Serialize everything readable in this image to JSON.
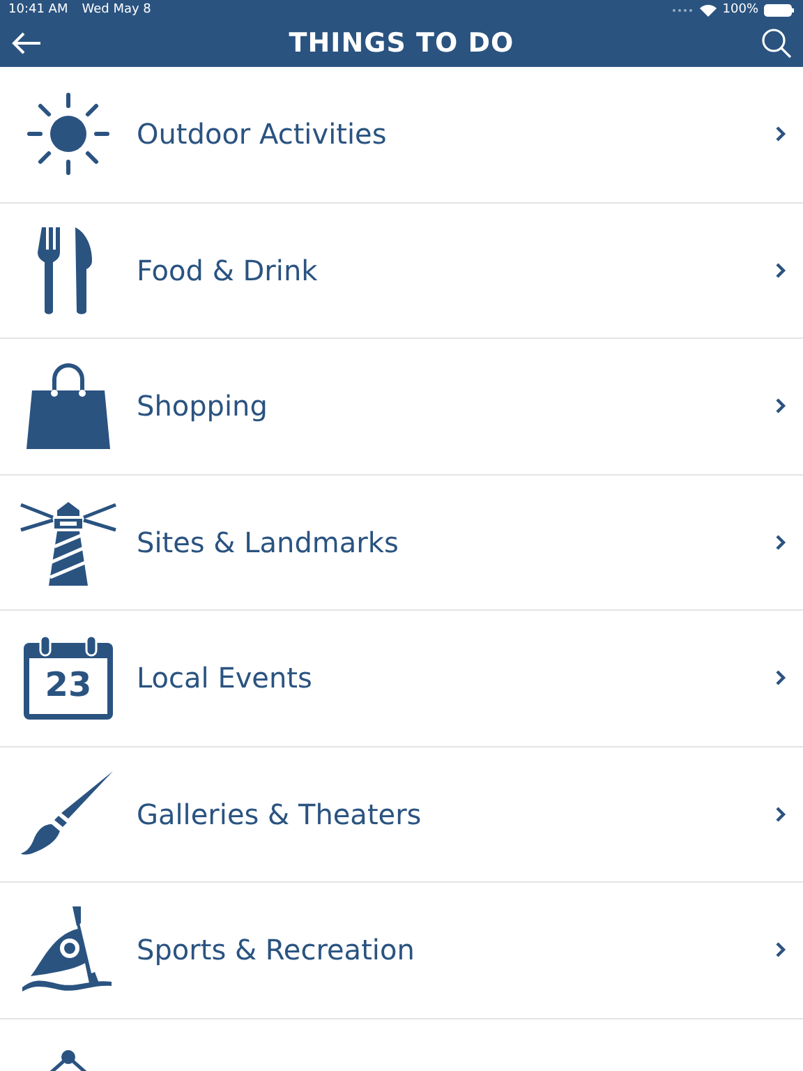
{
  "status_bar": {
    "time": "10:41 AM",
    "date": "Wed May 8",
    "battery": "100%"
  },
  "header": {
    "title": "THINGS TO DO"
  },
  "items": [
    {
      "kind": "sun",
      "label": "Outdoor Activities"
    },
    {
      "kind": "utensils",
      "label": "Food & Drink"
    },
    {
      "kind": "bag",
      "label": "Shopping"
    },
    {
      "kind": "lighthouse",
      "label": "Sites & Landmarks"
    },
    {
      "kind": "calendar",
      "label": "Local Events",
      "icon_text": "23"
    },
    {
      "kind": "brush",
      "label": "Galleries & Theaters"
    },
    {
      "kind": "kayak",
      "label": "Sports & Recreation"
    },
    {
      "kind": "frame"
    }
  ]
}
